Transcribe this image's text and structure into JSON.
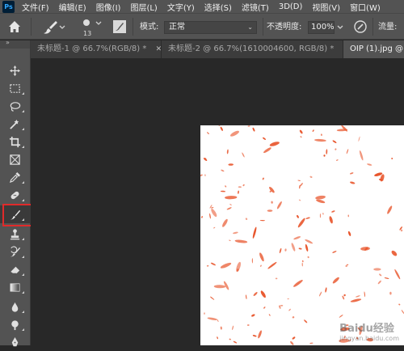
{
  "app": {
    "logo_text": "Ps"
  },
  "menu": [
    "文件(F)",
    "编辑(E)",
    "图像(I)",
    "图层(L)",
    "文字(Y)",
    "选择(S)",
    "滤镜(T)",
    "3D(D)",
    "视图(V)",
    "窗口(W)"
  ],
  "options": {
    "brush_size": "13",
    "mode_label": "模式:",
    "mode_value": "正常",
    "opacity_label": "不透明度:",
    "opacity_value": "100%",
    "flow_label": "流量:"
  },
  "tabs": [
    {
      "title": "未标题-1 @ 66.7%(RGB/8) *",
      "active": false
    },
    {
      "title": "未标题-2 @ 66.7%(1610004600, RGB/8) *",
      "active": false
    },
    {
      "title": "OIP (1).jpg @",
      "active": true
    }
  ],
  "toolbar": {
    "tools": [
      "move",
      "marquee",
      "lasso",
      "quick-selection",
      "crop",
      "frame",
      "eyedropper",
      "spot-healing",
      "brush",
      "clone-stamp",
      "history-brush",
      "eraser",
      "gradient",
      "blur",
      "dodge",
      "pen"
    ],
    "selected": "brush"
  },
  "colors": {
    "accent_highlight": "#e02a2a",
    "petal": "#e8542a",
    "canvas": "#ffffff"
  },
  "watermark": {
    "line1": "Baidu经验",
    "line2": "jingyan.baidu.com"
  }
}
